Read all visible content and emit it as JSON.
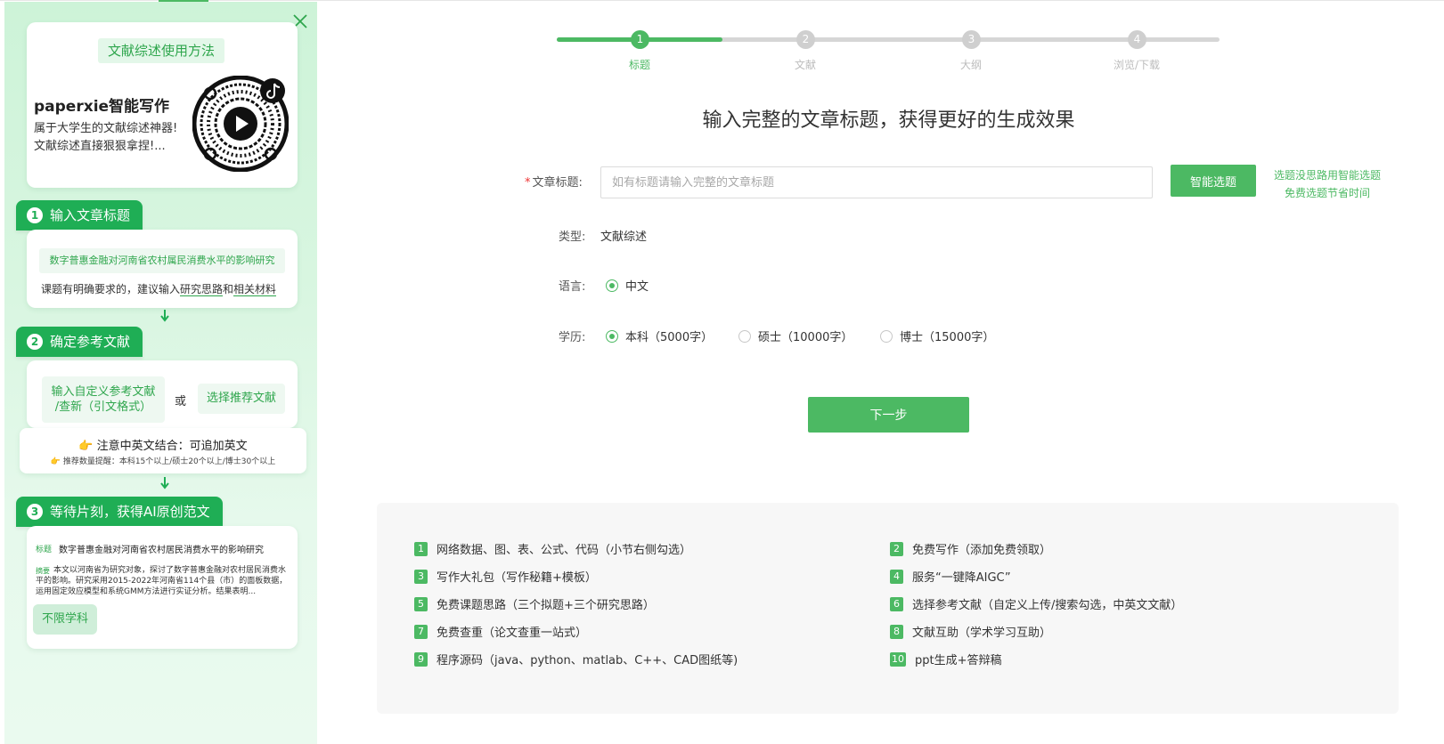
{
  "left_panel": {
    "intro": {
      "pill": "文献综述使用方法",
      "title": "paperxie智能写作",
      "desc_line1": "属于大学生的文献综述神器!",
      "desc_line2": "文献综述直接狠狠拿捏!..."
    },
    "step1": {
      "num": "1",
      "title": "输入文章标题",
      "example_topic": "数字普惠金融对河南省农村属民消费水平的影响研究",
      "hint_prefix": "课题有明确要求的，建议输入",
      "hint_link1": "研究思路",
      "hint_mid": "和",
      "hint_link2": "相关材料"
    },
    "step2": {
      "num": "2",
      "title": "确定参考文献",
      "btn_custom_line1": "输入自定义参考文献",
      "btn_custom_line2": "/查新（引文格式）",
      "or": "或",
      "btn_recommend": "选择推荐文献"
    },
    "note": {
      "main": "注意中英文结合：可追加英文",
      "sub": "推荐数量提醒：本科15个以上/硕士20个以上/博士30个以上"
    },
    "step3": {
      "num": "3",
      "title": "等待片刻，获得AI原创范文",
      "label_title": "标题",
      "sample_title": "数字普惠金融对河南省农村居民消费水平的影响研究",
      "label_abstract": "摘要",
      "abstract": "本文以河南省为研究对象，探讨了数字普惠金融对农村居民消费水平的影响。研究采用2015-2022年河南省114个县（市）的面板数据，运用固定效应模型和系统GMM方法进行实证分析。结果表明...",
      "tag": "不限学科"
    }
  },
  "progress": {
    "steps": [
      {
        "num": "1",
        "label": "标题",
        "active": true
      },
      {
        "num": "2",
        "label": "文献",
        "active": false
      },
      {
        "num": "3",
        "label": "大纲",
        "active": false
      },
      {
        "num": "4",
        "label": "浏览/下载",
        "active": false
      }
    ],
    "completed_fraction": 0.25
  },
  "headline": "输入完整的文章标题，获得更好的生成效果",
  "form": {
    "title_label": "文章标题:",
    "required_mark": "*",
    "title_placeholder": "如有标题请输入完整的文章标题",
    "title_value": "",
    "smart_button": "智能选题",
    "smart_tip_line1": "选题没思路用智能选题",
    "smart_tip_line2": "免费选题节省时间",
    "type_label": "类型:",
    "type_value": "文献综述",
    "language_label": "语言:",
    "language_option": "中文",
    "degree_label": "学历:",
    "degree_options": [
      {
        "label": "本科（5000字）",
        "selected": true
      },
      {
        "label": "硕士（10000字）",
        "selected": false
      },
      {
        "label": "博士（15000字）",
        "selected": false
      }
    ],
    "next_button": "下一步"
  },
  "benefits": [
    {
      "num": "1",
      "text": "网络数据、图、表、公式、代码（小节右侧勾选）"
    },
    {
      "num": "2",
      "text": "免费写作（添加免费领取）"
    },
    {
      "num": "3",
      "text": "写作大礼包（写作秘籍+模板）"
    },
    {
      "num": "4",
      "text": "服务“一键降AIGC”"
    },
    {
      "num": "5",
      "text": "免费课题思路（三个拟题+三个研究思路）"
    },
    {
      "num": "6",
      "text": "选择参考文献（自定义上传/搜索勾选，中英文文献）"
    },
    {
      "num": "7",
      "text": "免费查重（论文查重一站式）"
    },
    {
      "num": "8",
      "text": "文献互助（学术学习互助）"
    },
    {
      "num": "9",
      "text": "程序源码（java、python、matlab、C++、CAD图纸等)"
    },
    {
      "num": "10",
      "text": "ppt生成+答辩稿"
    }
  ],
  "colors": {
    "accent": "#4cb963",
    "tab_green": "#1fae55",
    "panel_bg": "#d9f6e1"
  }
}
